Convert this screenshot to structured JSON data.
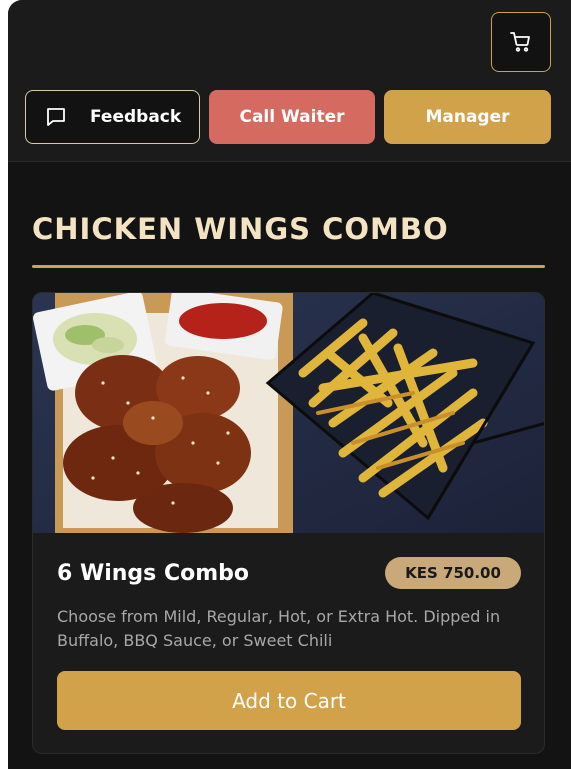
{
  "header": {
    "cart_icon": "cart-icon",
    "buttons": {
      "feedback_label": "Feedback",
      "feedback_icon": "chat-bubble-icon",
      "call_waiter_label": "Call Waiter",
      "manager_label": "Manager"
    }
  },
  "section": {
    "title": "CHICKEN WINGS COMBO"
  },
  "item": {
    "name": "6 Wings Combo",
    "price": "KES 750.00",
    "description": "Choose from Mild, Regular, Hot, or Extra Hot. Dipped in Buffalo, BBQ Sauce, or Sweet Chili",
    "add_to_cart_label": "Add to Cart"
  },
  "colors": {
    "background": "#131313",
    "header": "#1b1b1b",
    "accent_gold": "#d2a24a",
    "call_waiter": "#d46a60",
    "title": "#f4e3c2",
    "price_badge": "#c9a97a"
  }
}
